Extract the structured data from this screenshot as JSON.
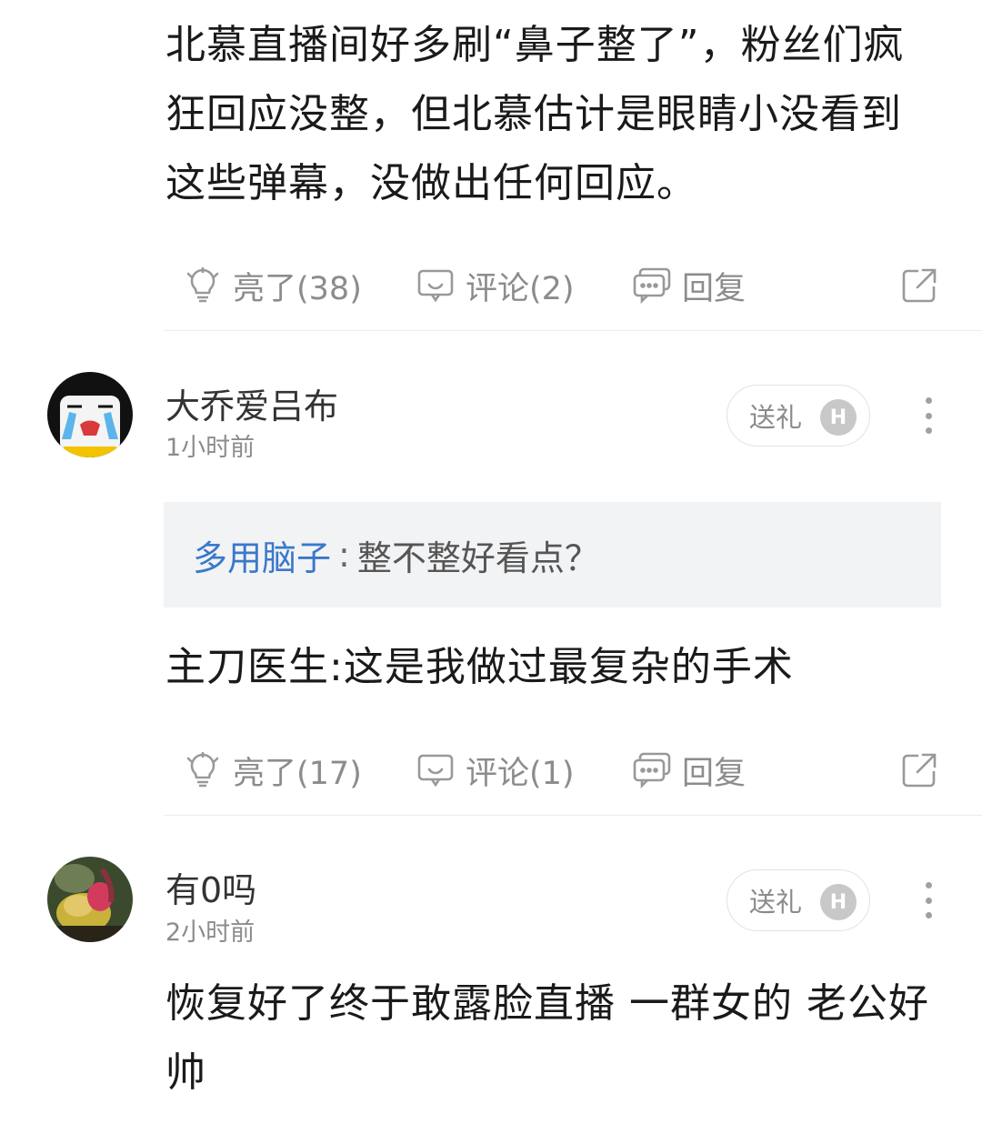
{
  "comments": [
    {
      "text": "北慕直播间好多刷“鼻子整了”，粉丝们疯狂回应没整，但北慕估计是眼睛小没看到这些弹幕，没做出任何回应。",
      "actions": {
        "light": "亮了(38)",
        "comment": "评论(2)",
        "reply": "回复"
      }
    },
    {
      "username": "大乔爱吕布",
      "time": "1小时前",
      "gift_label": "送礼",
      "gift_badge": "H",
      "quote": {
        "user": "多用脑子",
        "separator": ":",
        "text": "整不整好看点？"
      },
      "text": "主刀医生:这是我做过最复杂的手术",
      "actions": {
        "light": "亮了(17)",
        "comment": "评论(1)",
        "reply": "回复"
      }
    },
    {
      "username": "有0吗",
      "time": "2小时前",
      "gift_label": "送礼",
      "gift_badge": "H",
      "text": "恢复好了终于敢露脸直播 一群女的 老公好帅"
    }
  ],
  "icons": [
    "lightbulb-icon",
    "comment-icon",
    "reply-icon",
    "share-icon",
    "more-icon"
  ],
  "colors": {
    "link_blue": "#3a78c9",
    "muted_gray": "#8c8c8c",
    "quote_bg": "#f2f3f5"
  }
}
